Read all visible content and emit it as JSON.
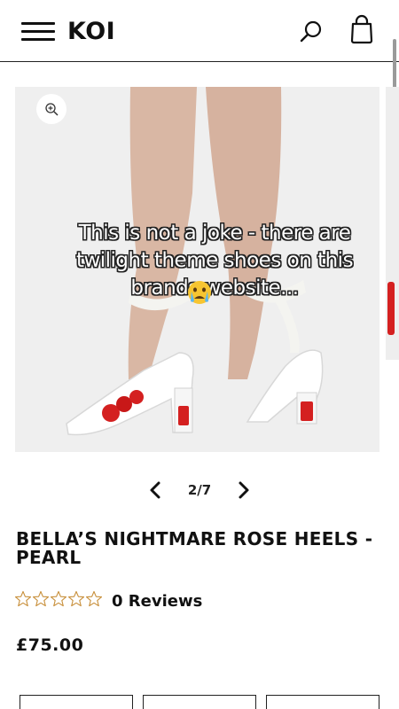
{
  "header": {
    "logo": "KOI",
    "icons": [
      "menu-icon",
      "search-icon",
      "shopping-bag-icon"
    ]
  },
  "gallery": {
    "image_description_icon": "zoom-in-icon",
    "overlay_caption": "This is not a joke - there are twilight theme shoes on this brands website...",
    "overlay_emoji": "crying-face-emoji",
    "page_indicator": "2/7"
  },
  "product": {
    "title": "BELLA’S NIGHTMARE ROSE HEELS - PEARL",
    "rating_stars": 0,
    "rating_max": 5,
    "reviews_label": "0 Reviews",
    "price": "£75.00"
  },
  "colors": {
    "text": "#111111",
    "background": "#ffffff",
    "star_outline": "#c8903c",
    "accent_red": "#d42020"
  }
}
